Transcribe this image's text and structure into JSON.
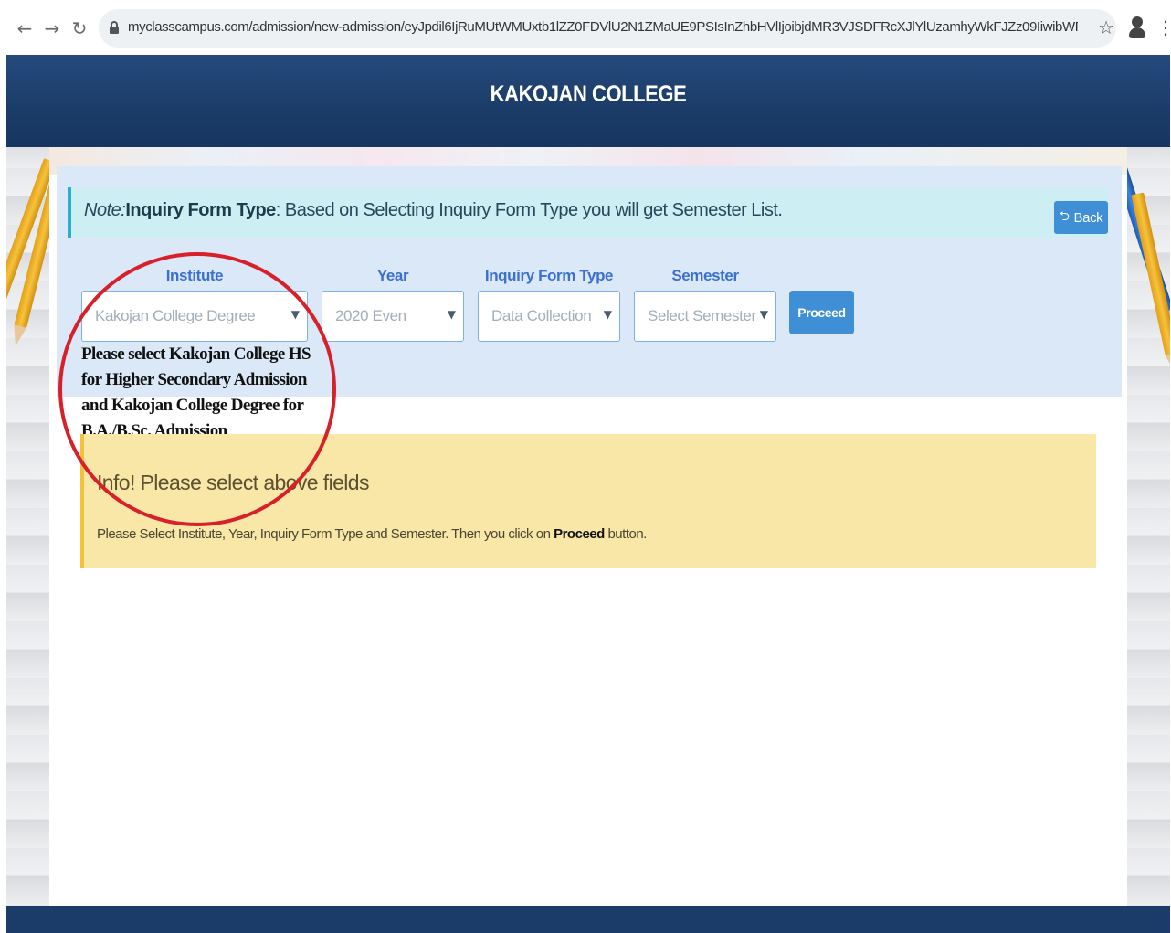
{
  "browser": {
    "back_icon": "arrow-left-icon",
    "forward_icon": "arrow-right-icon",
    "reload_icon": "reload-icon",
    "url": "myclasscampus.com/admission/new-admission/eyJpdil6IjRuMUtWMUxtb1lZZ0FDVlU2N1ZMaUE9PSIsInZhbHVlIjoibjdMR3VJSDFRcXJlYlUzamhyWkFJZz09IiwibWFjIjoiZmZiYWUyMjl...",
    "star_icon": "star-icon",
    "profile_icon": "profile-icon",
    "menu_icon": "kebab-menu-icon"
  },
  "header": {
    "title": "KAKOJAN COLLEGE"
  },
  "note": {
    "prefix": "Note:",
    "bold": "Inquiry Form Type",
    "text": ": Based on Selecting Inquiry Form Type you will get Semester List."
  },
  "back_button": {
    "label": "Back",
    "icon": "reply-icon"
  },
  "form": {
    "institute": {
      "label": "Institute",
      "value": "Kakojan College Degree"
    },
    "year": {
      "label": "Year",
      "value": "2020 Even"
    },
    "inquiry_form_type": {
      "label": "Inquiry Form Type",
      "value": "Data Collection"
    },
    "semester": {
      "label": "Semester",
      "value": "Select Semester"
    },
    "proceed_label": "Proceed"
  },
  "callout": {
    "text": "Please select Kakojan College HS for Higher Secondary Admission and Kakojan College Degree for B.A./B.Sc. Admission"
  },
  "info": {
    "title": "Info! Please select above fields",
    "text_before": "Please Select Institute, Year, Inquiry Form Type and Semester. Then you click on ",
    "text_bold": "Proceed",
    "text_after": " button."
  },
  "colors": {
    "header_bg": "#1b3c68",
    "accent_blue": "#3f8fd7",
    "label_blue": "#3c6fd0",
    "info_bg": "#f8e7a7",
    "note_bg": "#cdeef2",
    "annotation_red": "#d8202a"
  }
}
